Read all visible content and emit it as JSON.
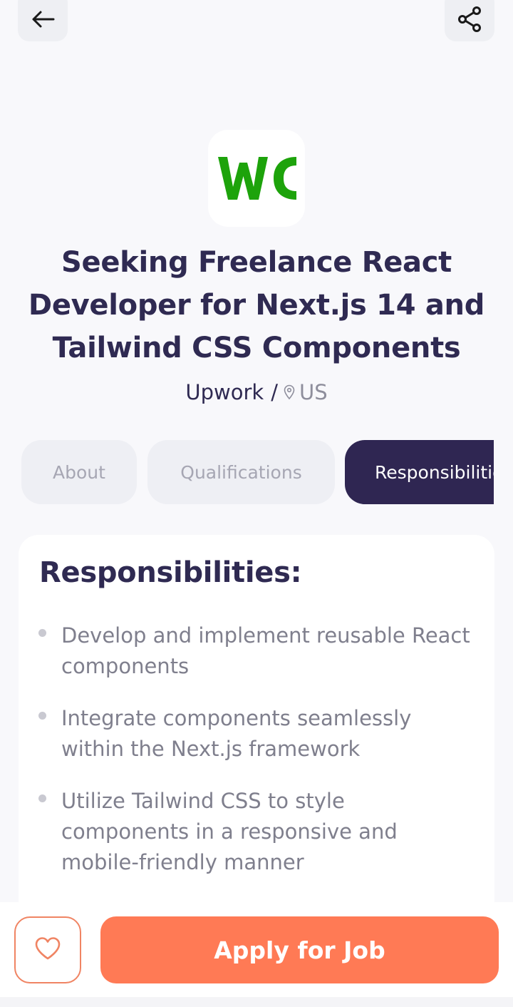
{
  "header": {
    "back_icon": "arrow-left-icon",
    "share_icon": "share-icon"
  },
  "company_logo": {
    "text": "WC",
    "color": "#1DA30B",
    "background": "#FFFFFF"
  },
  "job": {
    "title": "Seeking Freelance React Developer for Next.js 14 and Tailwind CSS Components",
    "company": "Upwork",
    "separator": "/",
    "location_icon": "map-pin-icon",
    "location": "US"
  },
  "tabs": [
    {
      "label": "About",
      "active": false
    },
    {
      "label": "Qualifications",
      "active": false
    },
    {
      "label": "Responsibilities",
      "active": true
    }
  ],
  "section": {
    "heading": "Responsibilities:",
    "items": [
      "Develop and implement reusable React components",
      "Integrate components seamlessly within the Next.js framework",
      "Utilize Tailwind CSS to style components in a responsive and mobile-friendly manner"
    ]
  },
  "footer": {
    "favorite_icon": "heart-icon",
    "apply_label": "Apply for Job"
  },
  "colors": {
    "primary_dark": "#2F2652",
    "accent": "#FF7A55",
    "muted_text": "#7F7F8D",
    "background": "#F8F8FB"
  }
}
